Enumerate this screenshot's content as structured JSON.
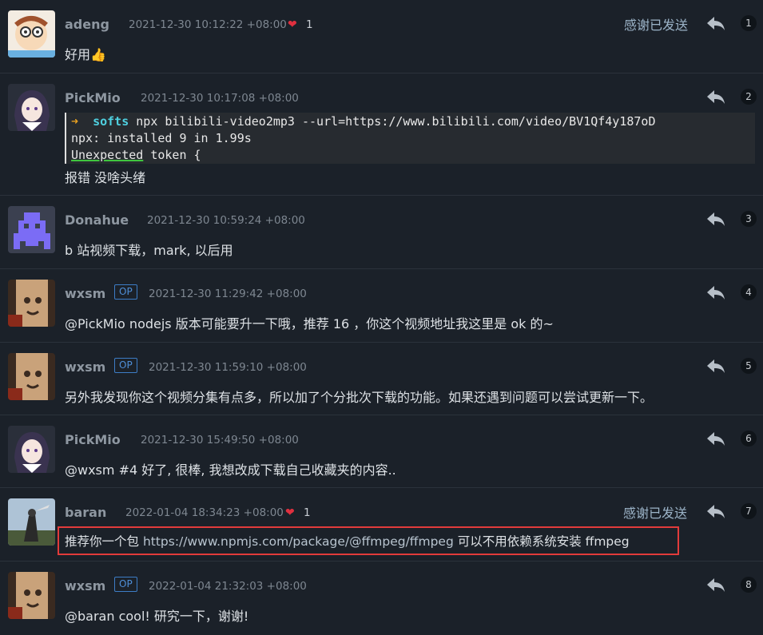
{
  "replies": [
    {
      "user": "adeng",
      "time": "2021-12-30 10:12:22 +08:00",
      "likes": "1",
      "thanked": "感谢已发送",
      "number": "1",
      "content": "好用👍"
    },
    {
      "user": "PickMio",
      "time": "2021-12-30 10:17:08 +08:00",
      "number": "2",
      "code": {
        "line1_arrow": "➜",
        "line1_cmd": "softs",
        "line1_rest": " npx bilibili-video2mp3 --url=https://www.bilibili.com/video/BV1Qf4y187oD",
        "line2": "npx: installed 9 in 1.99s",
        "line3_a": "Unexpected",
        "line3_b": " token {"
      },
      "content": "报错 没啥头绪"
    },
    {
      "user": "Donahue",
      "time": "2021-12-30 10:59:24 +08:00",
      "number": "3",
      "content": "b 站视频下载，mark, 以后用"
    },
    {
      "user": "wxsm",
      "op": "OP",
      "time": "2021-12-30 11:29:42 +08:00",
      "number": "4",
      "content": "@PickMio nodejs 版本可能要升一下哦，推荐 16 ，你这个视频地址我这里是 ok 的~"
    },
    {
      "user": "wxsm",
      "op": "OP",
      "time": "2021-12-30 11:59:10 +08:00",
      "number": "5",
      "content": "另外我发现你这个视频分集有点多，所以加了个分批次下载的功能。如果还遇到问题可以尝试更新一下。"
    },
    {
      "user": "PickMio",
      "time": "2021-12-30 15:49:50 +08:00",
      "number": "6",
      "content": "@wxsm #4 好了, 很棒, 我想改成下载自己收藏夹的内容.."
    },
    {
      "user": "baran",
      "time": "2022-01-04 18:34:23 +08:00",
      "likes": "1",
      "thanked": "感谢已发送",
      "number": "7",
      "content_pre": "推荐你一个包 ",
      "content_link": "https://www.npmjs.com/package/@ffmpeg/ffmpeg",
      "content_post": " 可以不用依赖系统安装 ffmpeg"
    },
    {
      "user": "wxsm",
      "op": "OP",
      "time": "2022-01-04 21:32:03 +08:00",
      "number": "8",
      "content": "@baran cool! 研究一下，谢谢!"
    }
  ],
  "icons": {
    "reply": "reply-arrow-icon",
    "heart": "heart-icon"
  },
  "colors": {
    "background": "#1b2129",
    "heart": "#e0303f",
    "op_badge": "#3d7dc6",
    "highlight": "#e23b3b"
  }
}
